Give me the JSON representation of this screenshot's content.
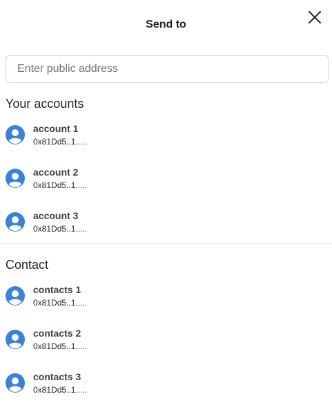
{
  "header": {
    "title": "Send to"
  },
  "search": {
    "placeholder": "Enter public address",
    "value": ""
  },
  "accounts": {
    "title": "Your accounts",
    "items": [
      {
        "name": "account 1",
        "address": "0x81Dd5..1....."
      },
      {
        "name": "account 2",
        "address": "0x81Dd5..1....."
      },
      {
        "name": "account 3",
        "address": "0x81Dd5..1....."
      }
    ]
  },
  "contacts": {
    "title": "Contact",
    "items": [
      {
        "name": "contacts 1",
        "address": "0x81Dd5..1....."
      },
      {
        "name": "contacts 2",
        "address": "0x81Dd5..1....."
      },
      {
        "name": "contacts 3",
        "address": "0x81Dd5..1....."
      }
    ]
  },
  "colors": {
    "avatar": "#3b82d6",
    "text": "#1f2328",
    "divider": "#eceef0"
  }
}
